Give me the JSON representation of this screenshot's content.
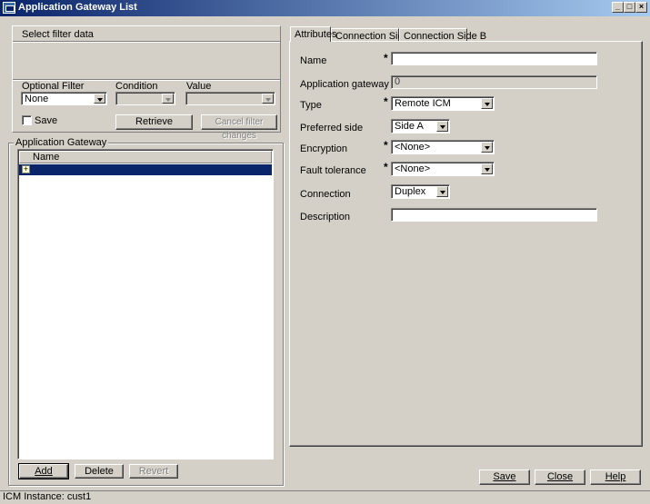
{
  "window": {
    "title": "Application Gateway List",
    "controls": {
      "minimize": "_",
      "maximize": "□",
      "close": "×"
    }
  },
  "filter": {
    "group_title": "Select filter data",
    "optional_filter_label": "Optional Filter",
    "optional_filter_value": "None",
    "condition_label": "Condition",
    "condition_value": "",
    "value_label": "Value",
    "value_value": "",
    "save_label": "Save",
    "save_checked": false,
    "retrieve_label": "Retrieve",
    "cancel_label": "Cancel filter changes"
  },
  "gateway_list": {
    "group_title": "Application Gateway",
    "column_header": "Name",
    "rows": [
      {
        "name": "",
        "expander": "+"
      }
    ]
  },
  "list_buttons": {
    "add": "Add",
    "delete": "Delete",
    "revert": "Revert"
  },
  "tabs": [
    {
      "label": "Attributes",
      "active": true
    },
    {
      "label": "Connection Side A",
      "active": false
    },
    {
      "label": "Connection Side B",
      "active": false
    }
  ],
  "attributes": {
    "required_mark": "*",
    "name_label": "Name",
    "name_value": "",
    "gateway_id_label": "Application gateway ID",
    "gateway_id_value": "0",
    "type_label": "Type",
    "type_value": "Remote ICM",
    "preferred_side_label": "Preferred side",
    "preferred_side_value": "Side A",
    "encryption_label": "Encryption",
    "encryption_value": "<None>",
    "fault_tolerance_label": "Fault tolerance",
    "fault_tolerance_value": "<None>",
    "connection_label": "Connection",
    "connection_value": "Duplex",
    "description_label": "Description",
    "description_value": ""
  },
  "footer_buttons": {
    "save": "Save",
    "close": "Close",
    "help": "Help"
  },
  "status": {
    "text": "ICM Instance: cust1"
  },
  "colors": {
    "title_start": "#0a246a",
    "title_end": "#a6caf0",
    "face": "#d4d0c8",
    "selection": "#0a246a"
  }
}
